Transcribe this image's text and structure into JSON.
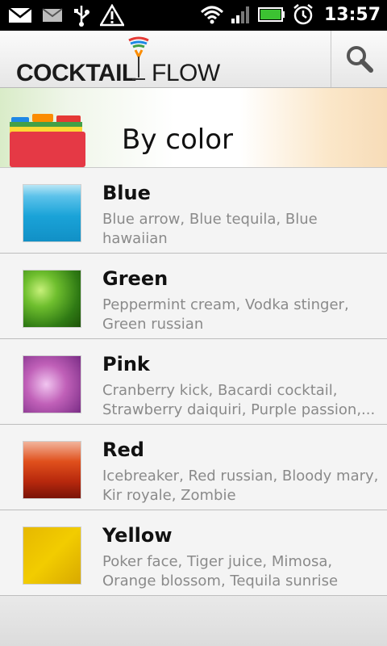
{
  "status_bar": {
    "time": "13:57",
    "icons": [
      "mail-icon",
      "gmail-icon",
      "usb-icon",
      "warning-icon",
      "wifi-icon",
      "signal-icon",
      "battery-icon",
      "alarm-icon"
    ]
  },
  "app": {
    "logo_left": "COCKTAIL",
    "logo_right": "FLOW",
    "search_icon": "search-icon"
  },
  "category": {
    "title": "By color"
  },
  "colors": {
    "accent_green": "#2f7a14",
    "accent_orange": "#f7dcb8"
  },
  "list": [
    {
      "title": "Blue",
      "subtitle": "Blue arrow, Blue tequila, Blue hawaiian"
    },
    {
      "title": "Green",
      "subtitle": "Peppermint cream, Vodka stinger, Green russian"
    },
    {
      "title": "Pink",
      "subtitle": "Cranberry kick, Bacardi cocktail, Strawberry daiquiri, Purple passion,..."
    },
    {
      "title": "Red",
      "subtitle": "Icebreaker, Red russian, Bloody mary, Kir royale, Zombie"
    },
    {
      "title": "Yellow",
      "subtitle": "Poker face, Tiger juice, Mimosa, Orange blossom, Tequila sunrise"
    }
  ]
}
